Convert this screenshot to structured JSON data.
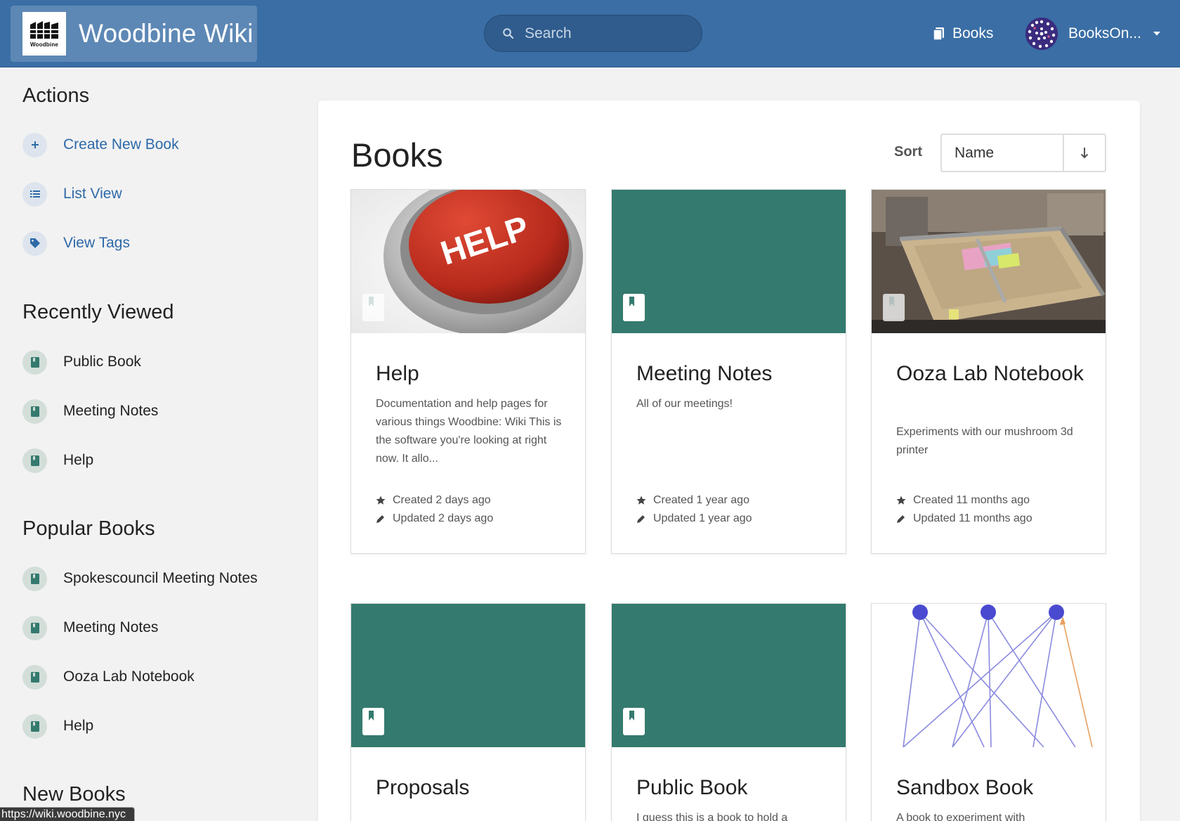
{
  "header": {
    "brand_name": "Woodbine Wiki",
    "logo_text": "Woodbine",
    "search_placeholder": "Search",
    "nav_books_label": "Books",
    "user_name": "BooksOn..."
  },
  "sidebar": {
    "actions_heading": "Actions",
    "actions": [
      {
        "label": "Create New Book",
        "icon": "plus-icon"
      },
      {
        "label": "List View",
        "icon": "list-icon"
      },
      {
        "label": "View Tags",
        "icon": "tag-icon"
      }
    ],
    "recent_heading": "Recently Viewed",
    "recent": [
      "Public Book",
      "Meeting Notes",
      "Help"
    ],
    "popular_heading": "Popular Books",
    "popular": [
      "Spokescouncil Meeting Notes",
      "Meeting Notes",
      "Ooza Lab Notebook",
      "Help"
    ],
    "new_heading": "New Books"
  },
  "status_url": "https://wiki.woodbine.nyc",
  "main": {
    "title": "Books",
    "sort_label": "Sort",
    "sort_value": "Name",
    "cards": [
      {
        "title": "Help",
        "cover_text": "HELP",
        "desc": "Documentation and help pages for various things Woodbine:  Wiki This is the software you're looking at right now. It allo...",
        "created": "Created 2 days ago",
        "updated": "Updated 2 days ago"
      },
      {
        "title": "Meeting Notes",
        "desc": "All of our meetings!",
        "created": "Created 1 year ago",
        "updated": "Updated 1 year ago"
      },
      {
        "title": "Ooza Lab Notebook",
        "desc": "Experiments with our mushroom 3d printer",
        "created": "Created 11 months ago",
        "updated": "Updated 11 months ago"
      },
      {
        "title": "Proposals"
      },
      {
        "title": "Public Book",
        "desc": "I guess this is a book to hold a"
      },
      {
        "title": "Sandbox Book",
        "desc": "A book to experiment with"
      }
    ]
  },
  "colors": {
    "header": "#3a6ea5",
    "accent_link": "#2e69a8",
    "teal_cover": "#347a6e",
    "background": "#f2f2f2"
  }
}
